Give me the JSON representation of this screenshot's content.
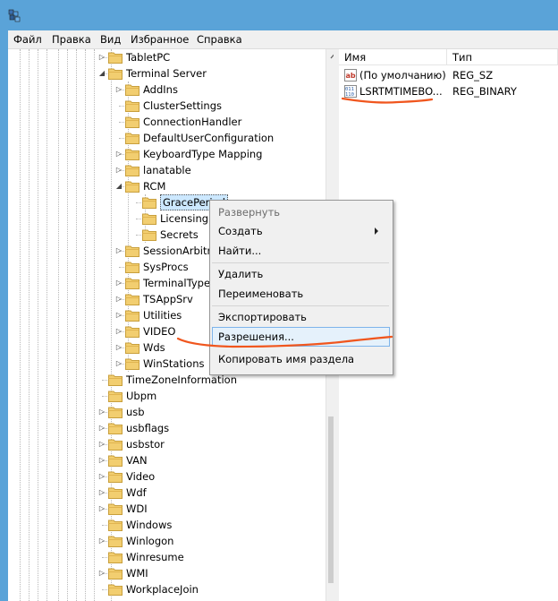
{
  "menubar": [
    "Файл",
    "Правка",
    "Вид",
    "Избранное",
    "Справка"
  ],
  "tree": [
    {
      "label": "TabletPC",
      "level": 1,
      "arrow": "collapsed"
    },
    {
      "label": "Terminal Server",
      "level": 1,
      "arrow": "expanded"
    },
    {
      "label": "AddIns",
      "level": 2,
      "arrow": "collapsed"
    },
    {
      "label": "ClusterSettings",
      "level": 2,
      "arrow": "none"
    },
    {
      "label": "ConnectionHandler",
      "level": 2,
      "arrow": "none"
    },
    {
      "label": "DefaultUserConfiguration",
      "level": 2,
      "arrow": "none"
    },
    {
      "label": "KeyboardType Mapping",
      "level": 2,
      "arrow": "collapsed"
    },
    {
      "label": "lanatable",
      "level": 2,
      "arrow": "collapsed"
    },
    {
      "label": "RCM",
      "level": 2,
      "arrow": "expanded"
    },
    {
      "label": "GracePeriod",
      "level": 3,
      "arrow": "none",
      "selected": true
    },
    {
      "label": "Licensing Core",
      "level": 3,
      "arrow": "none"
    },
    {
      "label": "Secrets",
      "level": 3,
      "arrow": "none"
    },
    {
      "label": "SessionArbitrationHelper",
      "level": 2,
      "arrow": "collapsed"
    },
    {
      "label": "SysProcs",
      "level": 2,
      "arrow": "none"
    },
    {
      "label": "TerminalTypes",
      "level": 2,
      "arrow": "collapsed"
    },
    {
      "label": "TSAppSrv",
      "level": 2,
      "arrow": "collapsed"
    },
    {
      "label": "Utilities",
      "level": 2,
      "arrow": "collapsed"
    },
    {
      "label": "VIDEO",
      "level": 2,
      "arrow": "collapsed"
    },
    {
      "label": "Wds",
      "level": 2,
      "arrow": "collapsed"
    },
    {
      "label": "WinStations",
      "level": 2,
      "arrow": "collapsed"
    },
    {
      "label": "TimeZoneInformation",
      "level": 1,
      "arrow": "none"
    },
    {
      "label": "Ubpm",
      "level": 1,
      "arrow": "none"
    },
    {
      "label": "usb",
      "level": 1,
      "arrow": "collapsed"
    },
    {
      "label": "usbflags",
      "level": 1,
      "arrow": "collapsed"
    },
    {
      "label": "usbstor",
      "level": 1,
      "arrow": "collapsed"
    },
    {
      "label": "VAN",
      "level": 1,
      "arrow": "collapsed"
    },
    {
      "label": "Video",
      "level": 1,
      "arrow": "collapsed"
    },
    {
      "label": "Wdf",
      "level": 1,
      "arrow": "collapsed"
    },
    {
      "label": "WDI",
      "level": 1,
      "arrow": "collapsed"
    },
    {
      "label": "Windows",
      "level": 1,
      "arrow": "none"
    },
    {
      "label": "Winlogon",
      "level": 1,
      "arrow": "collapsed"
    },
    {
      "label": "Winresume",
      "level": 1,
      "arrow": "none"
    },
    {
      "label": "WMI",
      "level": 1,
      "arrow": "collapsed"
    },
    {
      "label": "WorkplaceJoin",
      "level": 1,
      "arrow": "none"
    }
  ],
  "values_pane": {
    "col_name": "Имя",
    "col_type": "Тип",
    "rows": [
      {
        "name": "(По умолчанию)",
        "type": "REG_SZ",
        "icon": "string-value-icon"
      },
      {
        "name": "LSRTMTIMEBO...",
        "type": "REG_BINARY",
        "icon": "binary-value-icon"
      }
    ]
  },
  "context_menu": {
    "expand": "Развернуть",
    "create": "Создать",
    "find": "Найти...",
    "delete": "Удалить",
    "rename": "Переименовать",
    "export": "Экспортировать",
    "permissions": "Разрешения...",
    "copy_key_name": "Копировать имя раздела"
  },
  "colors": {
    "title_bar": "#5aa3d8",
    "annotation": "#f0561e",
    "highlight": "#e5f1fb"
  }
}
